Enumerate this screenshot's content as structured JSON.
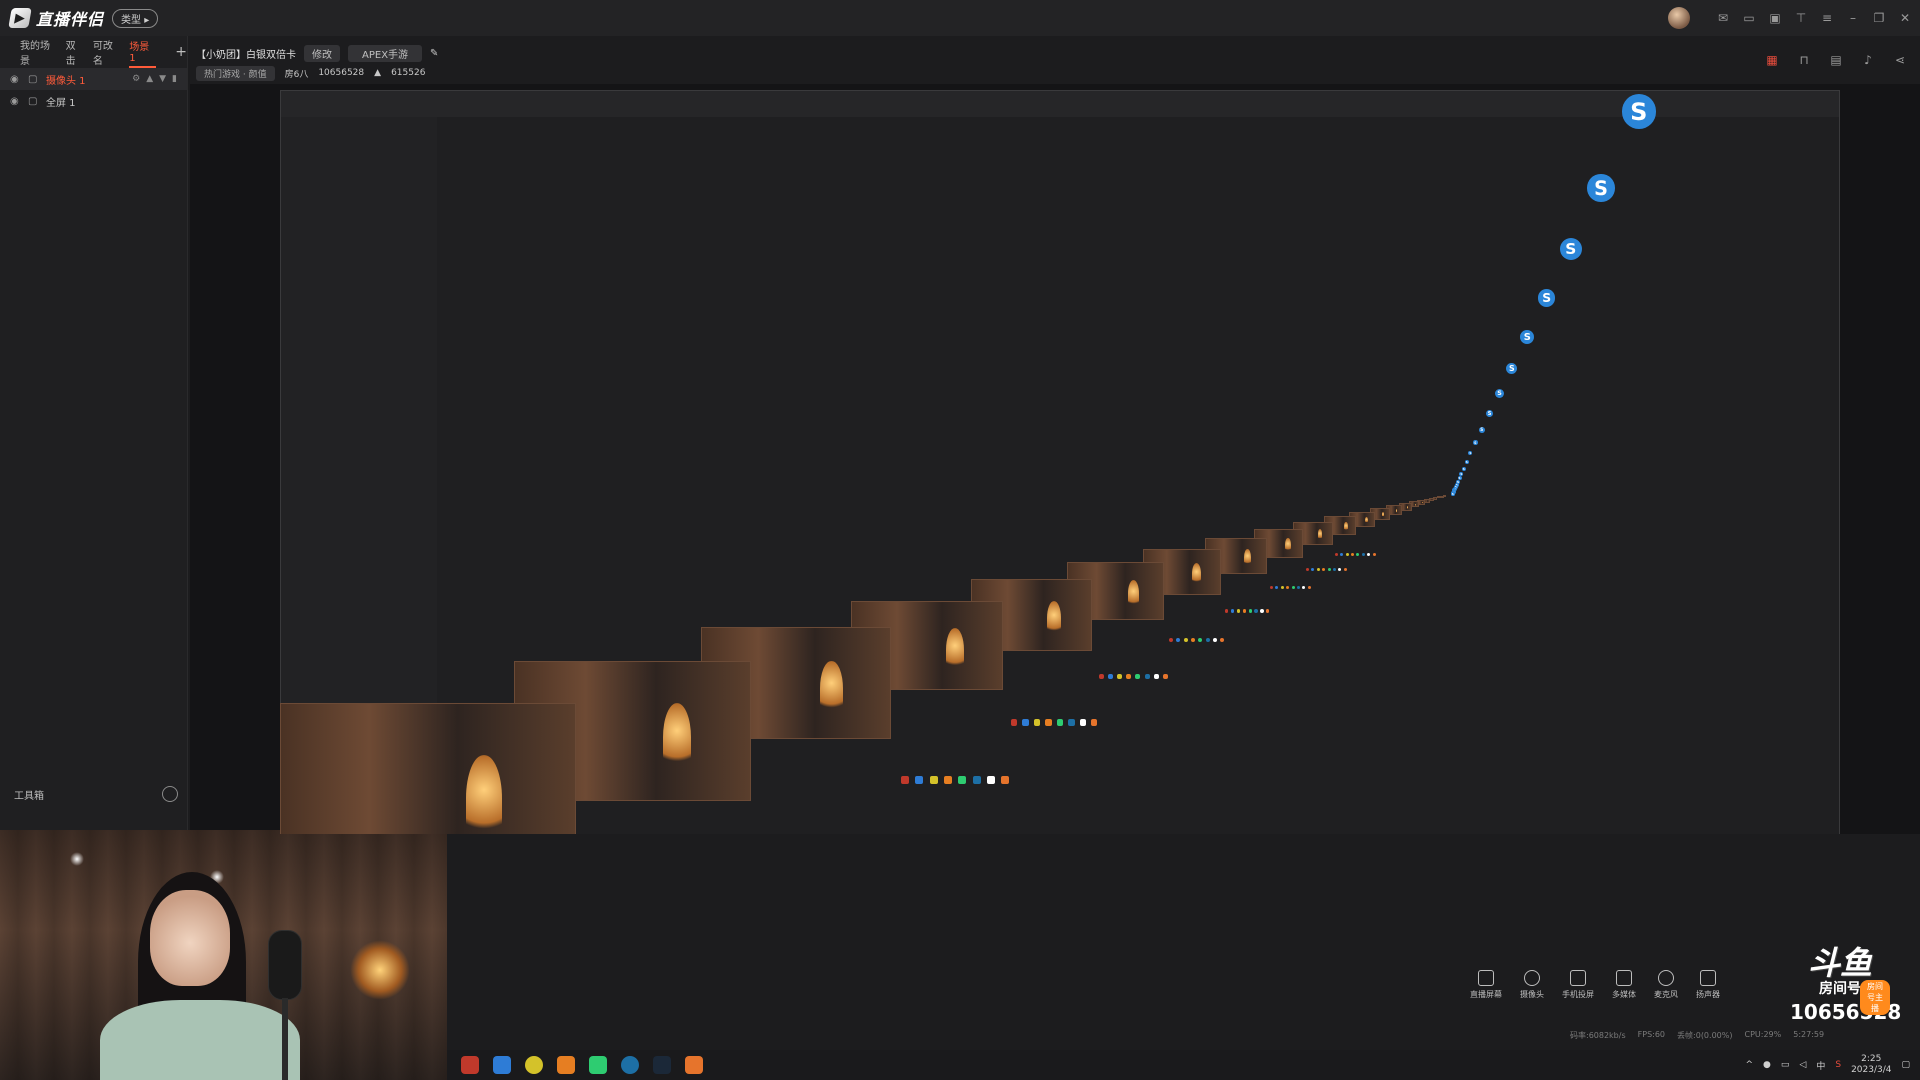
{
  "app": {
    "logo_text": "直播伴侣",
    "type_badge": "类型 ▸"
  },
  "scene_tabs": [
    {
      "label": "我的场景"
    },
    {
      "label": "双击"
    },
    {
      "label": "可改名"
    },
    {
      "label": "场景 1"
    }
  ],
  "sources": [
    {
      "label": "摄像头 1",
      "highlight": true
    },
    {
      "label": "全屏 1",
      "highlight": false
    }
  ],
  "toolbox": {
    "label": "工具箱"
  },
  "room": {
    "title": "【小奶团】白银双倍卡",
    "edit_label": "修改",
    "game": "APEX手游",
    "category": "热门游戏 · 颜值",
    "room_id": "10656528",
    "heat": "615526",
    "room_prefix": "房6八"
  },
  "bottom_tools": [
    {
      "label": "直播屏幕",
      "icon": "screen-icon"
    },
    {
      "label": "摄像头",
      "icon": "camera-icon"
    },
    {
      "label": "手机投屏",
      "icon": "phone-cast-icon"
    },
    {
      "label": "多媒体",
      "icon": "media-icon"
    },
    {
      "label": "麦克风",
      "icon": "mic-icon"
    },
    {
      "label": "扬声器",
      "icon": "speaker-icon"
    }
  ],
  "stats": {
    "bitrate": "码率:6082kb/s",
    "fps": "FPS:60",
    "drop": "丢帧:0(0.00%)",
    "cpu": "CPU:29%"
  },
  "watermark": {
    "logo": "斗鱼",
    "sub": "房间号",
    "room_number": "10656528",
    "tag": "房间号主播"
  },
  "clock": {
    "time": "2:25",
    "date": "2023/3/4",
    "duration": "5:27:59"
  },
  "tray": {
    "ime": "中"
  },
  "colors": {
    "accent": "#ff5b3a",
    "bg": "#1c1c1e"
  }
}
